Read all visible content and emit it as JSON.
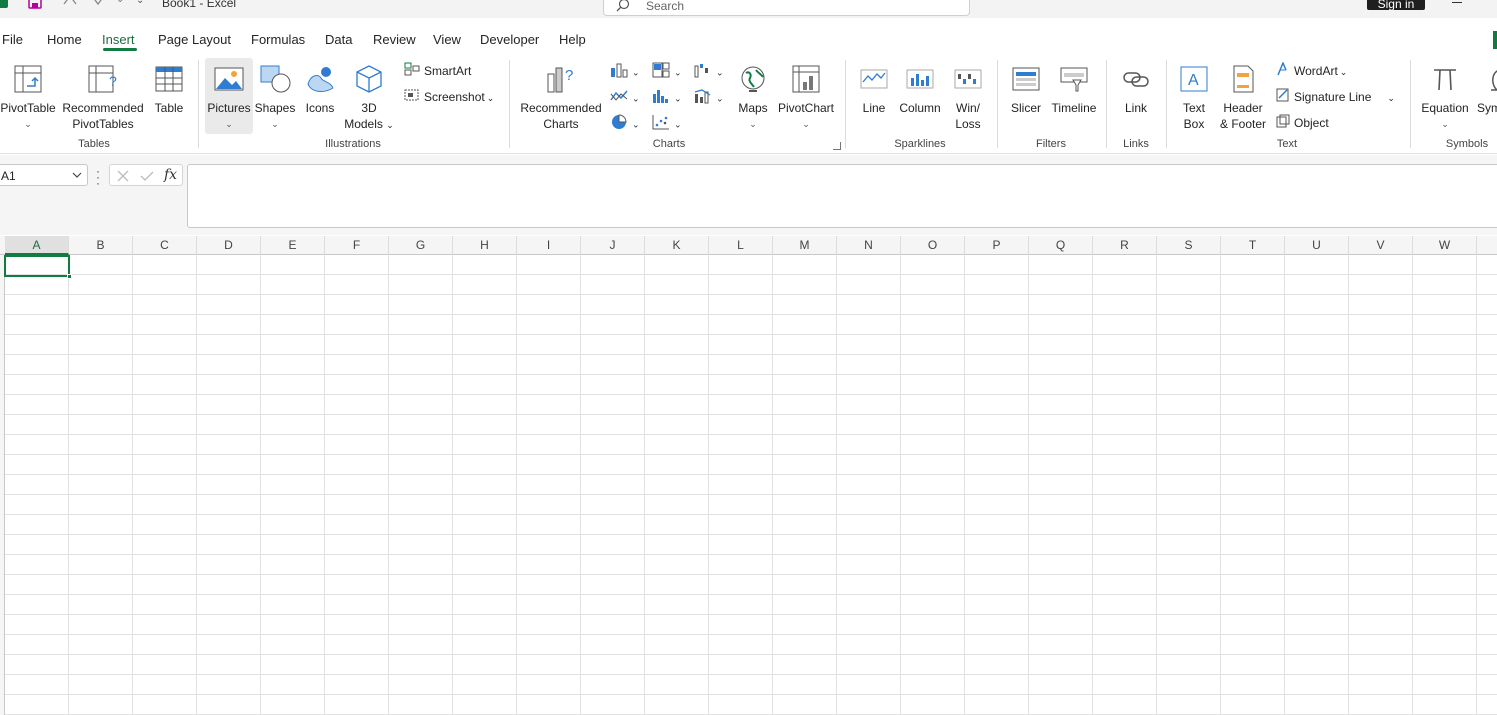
{
  "titlebar": {
    "doc_title": "Book1  -  Excel",
    "search_placeholder": "Search",
    "signin_label": "Sign in"
  },
  "tabs": [
    {
      "label": "File"
    },
    {
      "label": "Home"
    },
    {
      "label": "Insert",
      "active": true
    },
    {
      "label": "Page Layout"
    },
    {
      "label": "Formulas"
    },
    {
      "label": "Data"
    },
    {
      "label": "Review"
    },
    {
      "label": "View"
    },
    {
      "label": "Developer"
    },
    {
      "label": "Help"
    }
  ],
  "ribbon": {
    "groups": {
      "tables": "Tables",
      "illustrations": "Illustrations",
      "charts": "Charts",
      "sparklines": "Sparklines",
      "filters": "Filters",
      "links": "Links",
      "text": "Text",
      "symbols": "Symbols"
    },
    "buttons": {
      "pivottable": "PivotTable",
      "recommended_pivottables_1": "Recommended",
      "recommended_pivottables_2": "PivotTables",
      "table": "Table",
      "pictures": "Pictures",
      "shapes": "Shapes",
      "icons": "Icons",
      "models_1": "3D",
      "models_2": "Models",
      "smartart": "SmartArt",
      "screenshot": "Screenshot",
      "recommended_charts_1": "Recommended",
      "recommended_charts_2": "Charts",
      "maps": "Maps",
      "pivotchart": "PivotChart",
      "line": "Line",
      "column": "Column",
      "winloss_1": "Win/",
      "winloss_2": "Loss",
      "slicer": "Slicer",
      "timeline": "Timeline",
      "link": "Link",
      "textbox_1": "Text",
      "textbox_2": "Box",
      "header_footer_1": "Header",
      "header_footer_2": "& Footer",
      "wordart": "WordArt",
      "signature_line": "Signature Line",
      "object": "Object",
      "equation": "Equation",
      "symbol": "Sym"
    }
  },
  "formula_bar": {
    "name_box": "A1",
    "fx": "fx",
    "formula": ""
  },
  "grid": {
    "columns": [
      "A",
      "B",
      "C",
      "D",
      "E",
      "F",
      "G",
      "H",
      "I",
      "J",
      "K",
      "L",
      "M",
      "N",
      "O",
      "P",
      "Q",
      "R",
      "S",
      "T",
      "U",
      "V",
      "W"
    ],
    "active_cell": "A1"
  },
  "colors": {
    "accent": "#107c41",
    "chart_blue": "#2f7dd1"
  }
}
